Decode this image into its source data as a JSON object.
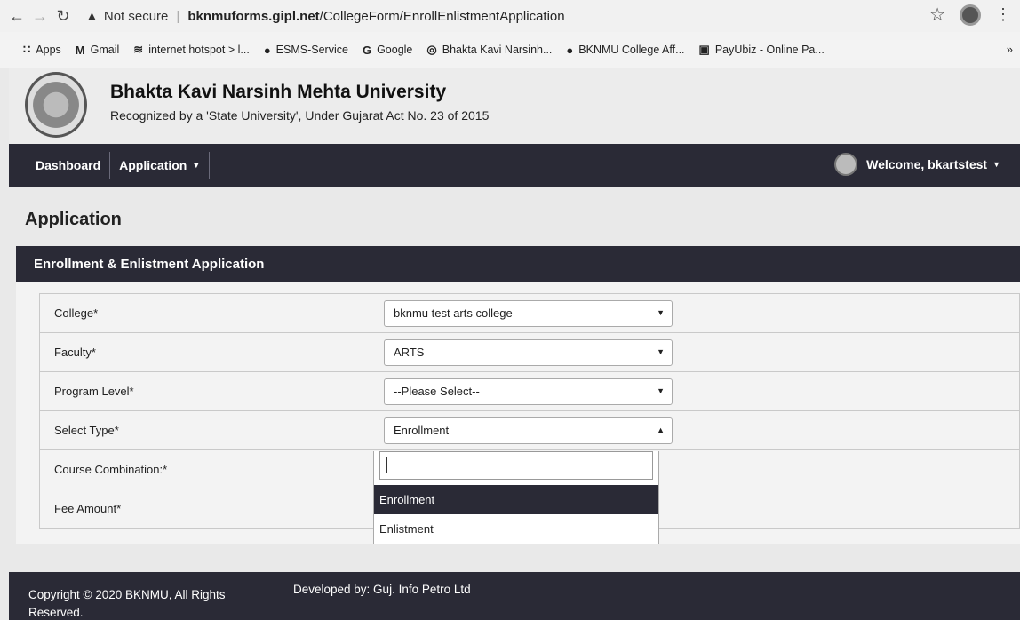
{
  "browser": {
    "security_text": "Not secure",
    "url_host": "bknmuforms.gipl.net",
    "url_path": "/CollegeForm/EnrollEnlistmentApplication",
    "bookmarks": [
      {
        "icon": "apps-icon",
        "glyph": "∷",
        "label": "Apps"
      },
      {
        "icon": "gmail-icon",
        "glyph": "M",
        "label": "Gmail"
      },
      {
        "icon": "wifi-icon",
        "glyph": "≋",
        "label": "internet hotspot > l..."
      },
      {
        "icon": "globe-icon",
        "glyph": "●",
        "label": "ESMS-Service"
      },
      {
        "icon": "google-icon",
        "glyph": "G",
        "label": "Google"
      },
      {
        "icon": "site-icon",
        "glyph": "◎",
        "label": "Bhakta Kavi Narsinh..."
      },
      {
        "icon": "globe-icon",
        "glyph": "●",
        "label": "BKNMU College Aff..."
      },
      {
        "icon": "payubiz-icon",
        "glyph": "▣",
        "label": "PayUbiz - Online Pa..."
      }
    ],
    "more": "»"
  },
  "header": {
    "title": "Bhakta Kavi Narsinh Mehta University",
    "subtitle": "Recognized by a 'State University', Under Gujarat Act No. 23 of 2015"
  },
  "navbar": {
    "dashboard": "Dashboard",
    "application": "Application",
    "welcome": "Welcome, bkartstest"
  },
  "page": {
    "title": "Application",
    "panel_title": "Enrollment & Enlistment Application"
  },
  "form": {
    "college_label": "College*",
    "college_value": "bknmu test arts college",
    "faculty_label": "Faculty*",
    "faculty_value": "ARTS",
    "program_label": "Program Level*",
    "program_value": "--Please Select--",
    "type_label": "Select Type*",
    "type_value": "Enrollment",
    "course_label": "Course Combination:*",
    "fee_label": "Fee Amount*"
  },
  "dropdown": {
    "options": [
      "Enrollment",
      "Enlistment"
    ],
    "selected": "Enrollment"
  },
  "footer": {
    "copyright": "Copyright © 2020 BKNMU, All Rights Reserved.",
    "developer": "Developed by: Guj. Info Petro Ltd"
  }
}
